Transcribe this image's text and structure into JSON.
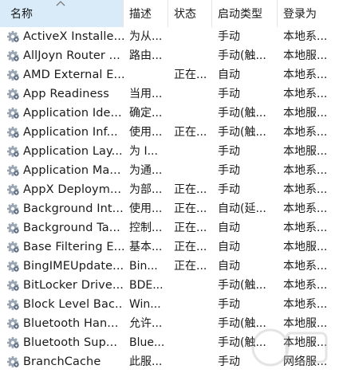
{
  "columns": {
    "name": "名称",
    "description": "描述",
    "status": "状态",
    "startup_type": "启动类型",
    "logon_as": "登录为"
  },
  "sort": {
    "column": "name",
    "direction": "ascending"
  },
  "icon": "service-gear-icon",
  "accent": "#d9ebf9",
  "services": [
    {
      "name": "ActiveX Installe...",
      "description": "为从...",
      "status": "",
      "startup_type": "手动",
      "logon_as": "本地系..."
    },
    {
      "name": "AllJoyn Router ...",
      "description": "路由...",
      "status": "",
      "startup_type": "手动(触...",
      "logon_as": "本地服..."
    },
    {
      "name": "AMD External E...",
      "description": "",
      "status": "正在...",
      "startup_type": "自动",
      "logon_as": "本地系..."
    },
    {
      "name": "App Readiness",
      "description": "当用...",
      "status": "",
      "startup_type": "手动",
      "logon_as": "本地系..."
    },
    {
      "name": "Application Ide...",
      "description": "确定...",
      "status": "",
      "startup_type": "手动(触...",
      "logon_as": "本地服..."
    },
    {
      "name": "Application Inf...",
      "description": "使用...",
      "status": "正在...",
      "startup_type": "手动(触...",
      "logon_as": "本地系..."
    },
    {
      "name": "Application Lay...",
      "description": "为 I...",
      "status": "",
      "startup_type": "手动",
      "logon_as": "本地服..."
    },
    {
      "name": "Application Ma...",
      "description": "为通...",
      "status": "",
      "startup_type": "手动",
      "logon_as": "本地系..."
    },
    {
      "name": "AppX Deploym...",
      "description": "为部...",
      "status": "正在...",
      "startup_type": "手动",
      "logon_as": "本地系..."
    },
    {
      "name": "Background Int...",
      "description": "使用...",
      "status": "正在...",
      "startup_type": "自动(延...",
      "logon_as": "本地系..."
    },
    {
      "name": "Background Ta...",
      "description": "控制...",
      "status": "正在...",
      "startup_type": "自动",
      "logon_as": "本地系..."
    },
    {
      "name": "Base Filtering E...",
      "description": "基本...",
      "status": "正在...",
      "startup_type": "自动",
      "logon_as": "本地服..."
    },
    {
      "name": "BingIMEUpdate...",
      "description": "Bin...",
      "status": "正在...",
      "startup_type": "自动",
      "logon_as": "本地系..."
    },
    {
      "name": "BitLocker Drive...",
      "description": "BDE...",
      "status": "",
      "startup_type": "手动(触...",
      "logon_as": "本地系..."
    },
    {
      "name": "Block Level Bac...",
      "description": "Win...",
      "status": "",
      "startup_type": "手动",
      "logon_as": "本地系..."
    },
    {
      "name": "Bluetooth Han...",
      "description": "允许...",
      "status": "",
      "startup_type": "手动(触...",
      "logon_as": "本地服..."
    },
    {
      "name": "Bluetooth Sup...",
      "description": "Blue...",
      "status": "",
      "startup_type": "手动(触...",
      "logon_as": "本地服..."
    },
    {
      "name": "BranchCache",
      "description": "此服...",
      "status": "",
      "startup_type": "手动",
      "logon_as": "网络服..."
    }
  ]
}
